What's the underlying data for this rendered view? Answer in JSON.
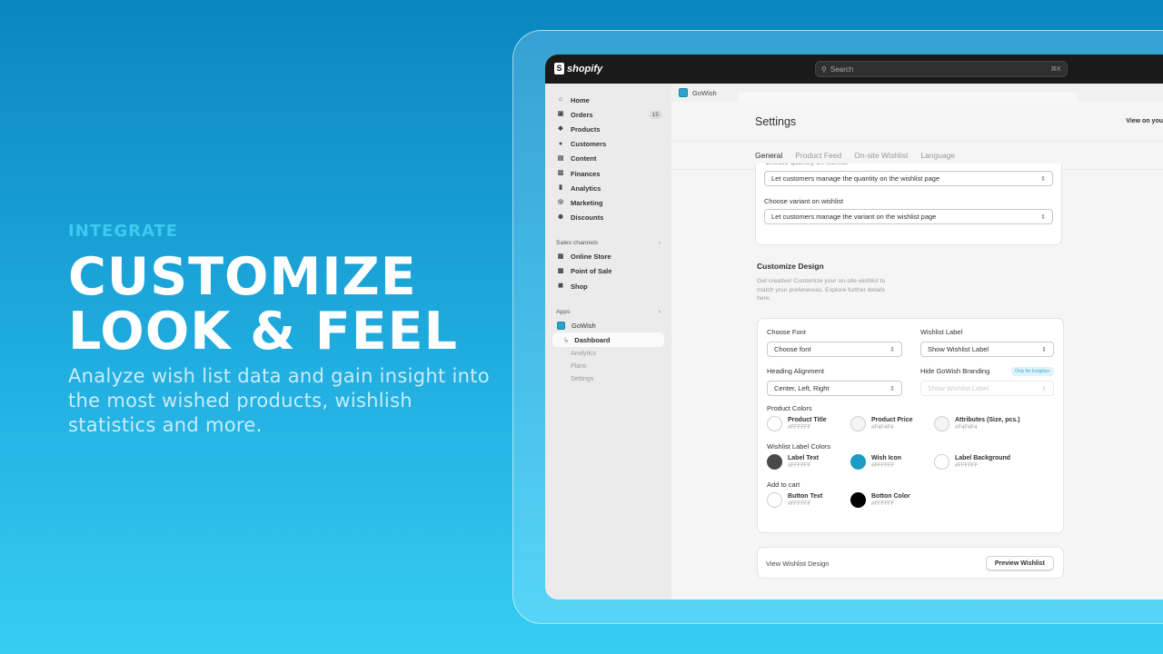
{
  "hero": {
    "eyebrow": "INTEGRATE",
    "headline_line1": "CUSTOMIZE",
    "headline_line2": "LOOK & FEEL",
    "subtext": "Analyze wish list data and gain insight into the most wished products, wishlish statistics and more."
  },
  "topbar": {
    "brand": "shopify",
    "search_placeholder": "Search",
    "search_shortcut": "⌘K"
  },
  "sidebar": {
    "items": [
      {
        "label": "Home",
        "icon": "⌂"
      },
      {
        "label": "Orders",
        "icon": "▣",
        "badge": "15"
      },
      {
        "label": "Products",
        "icon": "◆"
      },
      {
        "label": "Customers",
        "icon": "●"
      },
      {
        "label": "Content",
        "icon": "▤"
      },
      {
        "label": "Finances",
        "icon": "▥"
      },
      {
        "label": "Analytics",
        "icon": "▮"
      },
      {
        "label": "Marketing",
        "icon": "◎"
      },
      {
        "label": "Discounts",
        "icon": "✺"
      }
    ],
    "sales_channels_title": "Sales channels",
    "sales_channels": [
      {
        "label": "Online Store",
        "icon": "▦"
      },
      {
        "label": "Point of Sale",
        "icon": "▩"
      },
      {
        "label": "Shop",
        "icon": "◼"
      }
    ],
    "apps_title": "Apps",
    "app_name": "GoWish",
    "app_subitems": [
      "Dashboard",
      "Analytics",
      "Plans",
      "Settings"
    ],
    "chevron": "›"
  },
  "main": {
    "app_label": "GoWish",
    "title": "Settings",
    "view_link": "View on you",
    "tabs": [
      "General",
      "Product Feed",
      "On-site Wishlist",
      "Language"
    ],
    "quantity_label": "Choose quantity on wishlist",
    "quantity_value": "Let customers manage the quantity on the wishlist page",
    "variant_label": "Choose variant on wishlist",
    "variant_value": "Let customers manage the variant on the wishlist page",
    "design_title": "Customize Design",
    "design_desc": "Get creative! Customize your on-site wishlist to match your preferences. Explore further details here.",
    "font_label": "Choose Font",
    "font_value": "Choose font",
    "wishlist_label_label": "Wishlist Label",
    "wishlist_label_value": "Show Wishlist Label",
    "heading_label": "Heading Alignment",
    "heading_value": "Center, Left, Right",
    "branding_label": "Hide GoWish Branding",
    "branding_pill": "Only for Insights+",
    "branding_value": "Show Wishlist Label",
    "product_colors_label": "Product Colors",
    "product_colors": [
      {
        "name": "Product Title",
        "hex": "#FFFFFF",
        "swatch": "#ffffff"
      },
      {
        "name": "Product Price",
        "hex": "#F4F4F4",
        "swatch": "#f4f4f4"
      },
      {
        "name": "Attributes (Size, pcs.)",
        "hex": "#F4F4F4",
        "swatch": "#f4f4f4"
      }
    ],
    "label_colors_label": "Wishlist Label Colors",
    "label_colors": [
      {
        "name": "Label Text",
        "hex": "#FFFFFF",
        "swatch": "#4a4a4a"
      },
      {
        "name": "Wish Icon",
        "hex": "#FFFFFF",
        "swatch": "#1a9cc4"
      },
      {
        "name": "Label Background",
        "hex": "#FFFFFF",
        "swatch": "#ffffff"
      }
    ],
    "cart_label": "Add to cart",
    "cart_colors": [
      {
        "name": "Button Text",
        "hex": "#FFFFFF",
        "swatch": "#ffffff"
      },
      {
        "name": "Botton Color",
        "hex": "#FFFFFF",
        "swatch": "#000000"
      }
    ],
    "view_design_label": "View Wishlist Design",
    "preview_button": "Preview Wishlist",
    "select_arrow": "⇕"
  }
}
